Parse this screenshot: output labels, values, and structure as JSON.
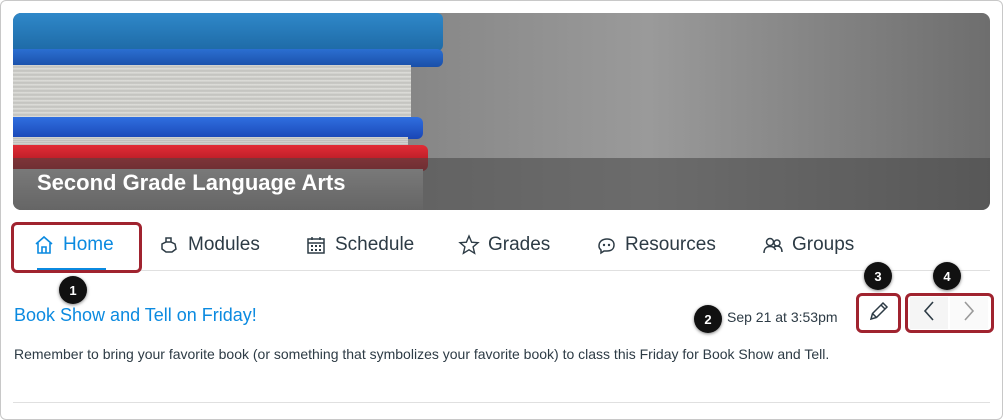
{
  "course": {
    "title": "Second Grade Language Arts"
  },
  "tabs": [
    {
      "label": "Home",
      "icon": "home-icon",
      "active": true
    },
    {
      "label": "Modules",
      "icon": "modules-icon"
    },
    {
      "label": "Schedule",
      "icon": "calendar-icon"
    },
    {
      "label": "Grades",
      "icon": "star-icon"
    },
    {
      "label": "Resources",
      "icon": "resources-icon"
    },
    {
      "label": "Groups",
      "icon": "groups-icon"
    }
  ],
  "announcement": {
    "title": "Book Show and Tell on Friday!",
    "date": "Sep 21 at 3:53pm",
    "body": "Remember to bring your favorite book (or something that symbolizes your favorite book) to class this Friday for Book Show and Tell."
  },
  "callouts": [
    "1",
    "2",
    "3",
    "4"
  ],
  "colors": {
    "accent": "#0b8ae0",
    "highlight": "#a0232f",
    "text": "#2d3b45"
  }
}
